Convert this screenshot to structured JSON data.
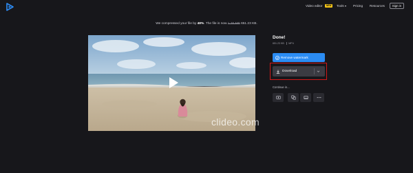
{
  "header": {
    "logo_icon": "clideo-play-logo",
    "nav": {
      "video_editor": "Video editor",
      "new_badge": "NEW",
      "tools": "Tools",
      "pricing": "Pricing",
      "resources": "Resources"
    },
    "sign_in": "Sign in"
  },
  "notice": {
    "prefix": "We compressed your file by",
    "percent": "48%",
    "middle": ". The file is now",
    "old_size": "1.26 MB",
    "new_size": "651.23 KB."
  },
  "player": {
    "watermark": "clideo.com",
    "play_icon": "play-icon"
  },
  "result": {
    "title": "Done!",
    "size": "651.23 KB",
    "format": "MP4"
  },
  "actions": {
    "remove_watermark": "Remove watermark",
    "download": "Download"
  },
  "continue": {
    "label": "Continue in...",
    "icons": [
      "compress-icon",
      "merge-icon",
      "crop-icon",
      "more-icon"
    ]
  },
  "colors": {
    "background": "#17171b",
    "primary_button": "#2b8cf3",
    "download_button": "#3b3b42",
    "highlight_border": "#d01818",
    "new_badge": "#f5c518"
  }
}
